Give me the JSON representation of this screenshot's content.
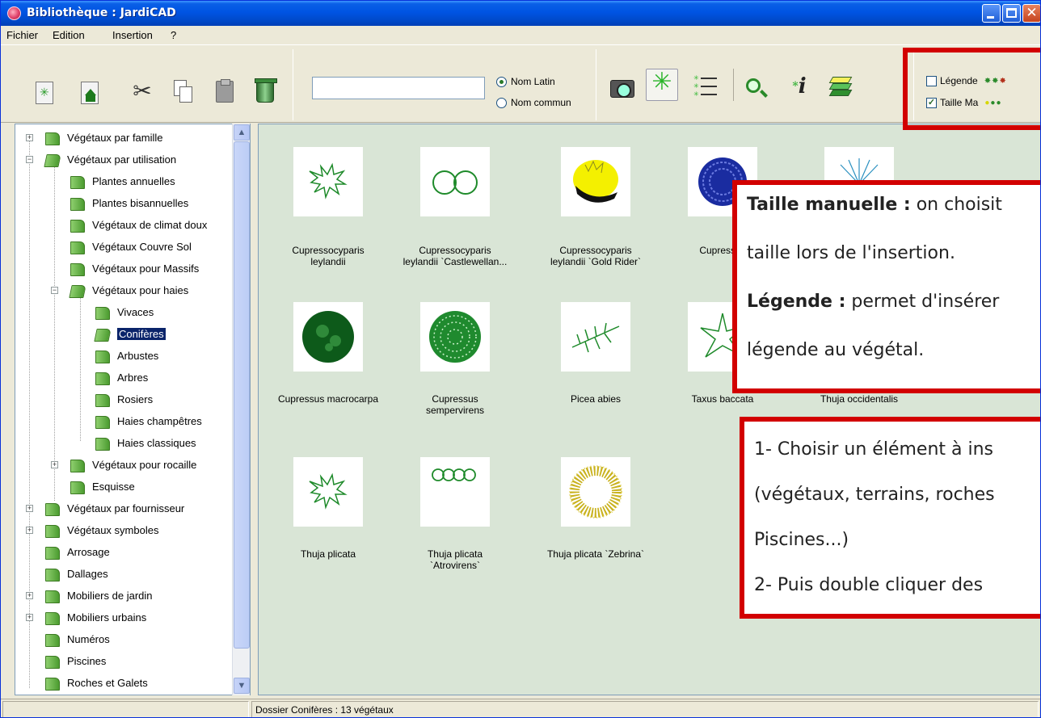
{
  "window": {
    "title": "Bibliothèque : JardiCAD",
    "min_glyph": "",
    "max_glyph": "",
    "close_glyph": "✕"
  },
  "menu": [
    "Fichier",
    "Edition",
    "Insertion",
    "?"
  ],
  "toolbar": {
    "search_value": "",
    "radio_latin": "Nom Latin",
    "radio_commun": "Nom commun",
    "radio_selected": "Nom Latin",
    "check_legende": "Légende",
    "check_legende_checked": false,
    "check_taille": "Taille Ma",
    "check_taille_checked": true
  },
  "tree": {
    "items": [
      {
        "label": "Végétaux par famille",
        "expander": "+"
      },
      {
        "label": "Végétaux par utilisation",
        "expander": "−"
      },
      {
        "label": "Plantes annuelles"
      },
      {
        "label": "Plantes bisannuelles"
      },
      {
        "label": "Végétaux de climat doux"
      },
      {
        "label": "Végétaux Couvre Sol"
      },
      {
        "label": "Végétaux pour Massifs"
      },
      {
        "label": "Végétaux pour haies",
        "expander": "−"
      },
      {
        "label": "Vivaces"
      },
      {
        "label": "Conifères",
        "selected": true
      },
      {
        "label": "Arbustes"
      },
      {
        "label": "Arbres"
      },
      {
        "label": "Rosiers"
      },
      {
        "label": "Haies champêtres"
      },
      {
        "label": "Haies classiques"
      },
      {
        "label": "Végétaux pour rocaille",
        "expander": "+"
      },
      {
        "label": "Esquisse"
      },
      {
        "label": "Végétaux par fournisseur",
        "expander": "+"
      },
      {
        "label": "Végétaux symboles",
        "expander": "+"
      },
      {
        "label": "Arrosage"
      },
      {
        "label": "Dallages"
      },
      {
        "label": "Mobiliers de jardin",
        "expander": "+"
      },
      {
        "label": "Mobiliers urbains",
        "expander": "+"
      },
      {
        "label": "Numéros"
      },
      {
        "label": "Piscines"
      },
      {
        "label": "Roches et Galets"
      }
    ]
  },
  "plants": [
    {
      "line1": "Cupressocyparis",
      "line2": "leylandii",
      "icon": "spiky-cluster-icon"
    },
    {
      "line1": "Cupressocyparis",
      "line2": "leylandii `Castlewellan...",
      "icon": "ring-pair-icon"
    },
    {
      "line1": "Cupressocyparis",
      "line2": "leylandii `Gold Rider`",
      "icon": "yellow-shrub-icon"
    },
    {
      "line1": "Cupressus",
      "line2": "",
      "icon": "blue-mesh-circle-icon"
    },
    {
      "line1": "",
      "line2": "",
      "icon": "blue-fan-icon"
    },
    {
      "line1": "Cupressus macrocarpa",
      "line2": "",
      "icon": "dark-green-tree-icon"
    },
    {
      "line1": "Cupressus",
      "line2": "sempervirens",
      "icon": "green-lace-tree-icon"
    },
    {
      "line1": "Picea abies",
      "line2": "",
      "icon": "branch-icon"
    },
    {
      "line1": "Taxus baccata",
      "line2": "",
      "icon": "star-plant-icon"
    },
    {
      "line1": "Thuja occidentalis",
      "line2": "",
      "icon": "hidden-icon"
    },
    {
      "line1": "Thuja plicata",
      "line2": "",
      "icon": "spiky-cluster-icon"
    },
    {
      "line1": "Thuja plicata",
      "line2": "`Atrovirens`",
      "icon": "ring-chain-icon"
    },
    {
      "line1": "Thuja plicata `Zebrina`",
      "line2": "",
      "icon": "golden-wreath-icon"
    }
  ],
  "status": {
    "folder_info": "Dossier Conifères : 13 végétaux"
  },
  "annotations": {
    "box1_line1_bold": "Taille manuelle :",
    "box1_line1_rest": " on choisit",
    "box1_line2": "taille lors de l'insertion.",
    "box1_line3_bold": "Légende :",
    "box1_line3_rest": " permet d'insérer",
    "box1_line4": "légende au végétal.",
    "box2_line1": "1- Choisir un élément à ins",
    "box2_line2": "(végétaux, terrains, roches",
    "box2_line3": "Piscines...)",
    "box2_line4": "2- Puis double cliquer des"
  },
  "colors": {
    "highlight_red": "#d20000",
    "content_bg": "#d9e5d6",
    "selection_blue": "#0a246a"
  }
}
